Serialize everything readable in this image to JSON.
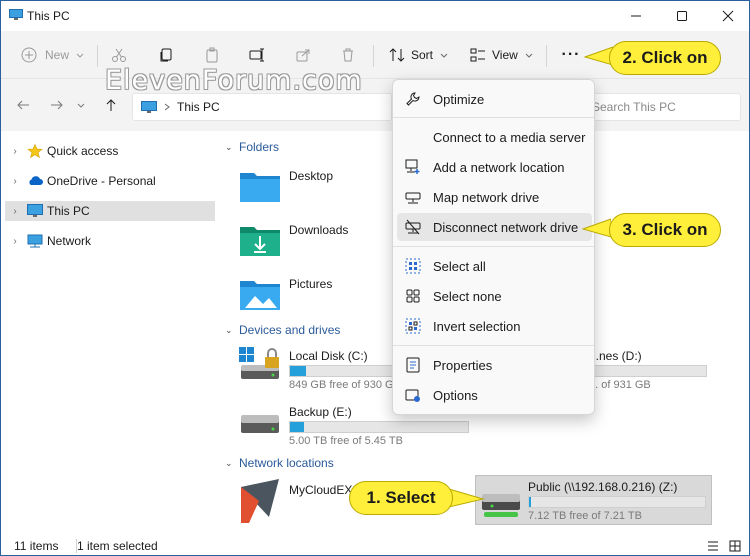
{
  "window": {
    "title": "This PC",
    "minimize_glyph": "—",
    "maximize_glyph": "☐",
    "close_glyph": "✕"
  },
  "toolbar": {
    "new_label": "New",
    "sort_label": "Sort",
    "view_label": "View",
    "more_label": "···"
  },
  "watermark": "ElevenForum.com",
  "address": {
    "path": "This PC",
    "search_placeholder": "Search This PC"
  },
  "sidebar": {
    "items": [
      {
        "label": "Quick access",
        "icon": "star-icon"
      },
      {
        "label": "OneDrive - Personal",
        "icon": "cloud-icon"
      },
      {
        "label": "This PC",
        "icon": "monitor-icon",
        "selected": true
      },
      {
        "label": "Network",
        "icon": "network-icon"
      }
    ]
  },
  "content": {
    "folders_header": "Folders",
    "folders": [
      {
        "name": "Desktop"
      },
      {
        "name": "Downloads"
      },
      {
        "name": "Pictures"
      }
    ],
    "devices_header": "Devices and drives",
    "drives": [
      {
        "name": "Local Disk (C:)",
        "free": "849 GB free of 930 GB",
        "used_fraction": 0.09
      },
      {
        "name": "...nes (D:)",
        "free": "... of 931 GB",
        "used_fraction": 0.03
      },
      {
        "name": "Backup (E:)",
        "free": "5.00 TB free of 5.45 TB",
        "used_fraction": 0.08
      }
    ],
    "network_header": "Network locations",
    "network_locations": [
      {
        "name": "MyCloudEX2"
      },
      {
        "name": "Public (\\\\192.168.0.216) (Z:)",
        "free": "7.12 TB free of 7.21 TB",
        "used_fraction": 0.012
      }
    ]
  },
  "menu": {
    "items": [
      {
        "label": "Optimize",
        "icon": "wrench-icon"
      },
      {
        "label": "Connect to a media server",
        "icon": ""
      },
      {
        "label": "Add a network location",
        "icon": "add-network-location-icon"
      },
      {
        "label": "Map network drive",
        "icon": "map-drive-icon"
      },
      {
        "label": "Disconnect network drive",
        "icon": "disconnect-drive-icon",
        "hover": true
      },
      {
        "label": "Select all",
        "icon": "select-all-icon"
      },
      {
        "label": "Select none",
        "icon": "select-none-icon"
      },
      {
        "label": "Invert selection",
        "icon": "invert-selection-icon"
      },
      {
        "label": "Properties",
        "icon": "properties-icon"
      },
      {
        "label": "Options",
        "icon": "options-icon"
      }
    ]
  },
  "callouts": {
    "step1": "1. Select",
    "step2": "2. Click on",
    "step3": "3. Click on"
  },
  "status": {
    "count": "11 items",
    "selection": "1 item selected"
  },
  "colors": {
    "accent": "#26a0da",
    "callout": "#ffef3a",
    "link": "#2a5a9a"
  }
}
